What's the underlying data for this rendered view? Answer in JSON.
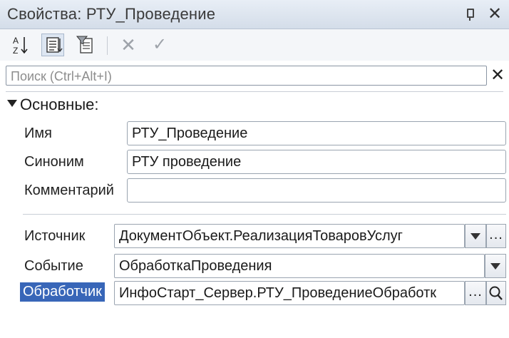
{
  "window": {
    "title": "Свойства: РТУ_Проведение",
    "close_glyph": "✕"
  },
  "toolbar": {
    "sort_label": "A Z",
    "cancel_glyph": "✕",
    "confirm_glyph": "✓"
  },
  "search": {
    "placeholder": "Поиск (Ctrl+Alt+I)",
    "value": "",
    "clear_glyph": "✕"
  },
  "groups": {
    "main": {
      "title": "Основные:"
    }
  },
  "properties": {
    "name": {
      "label": "Имя",
      "value": "РТУ_Проведение"
    },
    "synonym": {
      "label": "Синоним",
      "value": "РТУ проведение"
    },
    "comment": {
      "label": "Комментарий",
      "value": ""
    },
    "source": {
      "label": "Источник",
      "value": "ДокументОбъект.РеализацияТоваровУслуг",
      "select_glyph": "..."
    },
    "event": {
      "label": "Событие",
      "value": "ОбработкаПроведения"
    },
    "handler": {
      "label": "Обработчик",
      "value": "ИнфоСтарт_Сервер.РТУ_ПроведениеОбработк"
    }
  },
  "icons": {
    "window_pin": "pin-icon",
    "window_close": "close-icon",
    "sort": "sort-alphabetical-icon",
    "tree_view": "tree-view-icon",
    "filter": "filter-icon",
    "cancel": "cancel-icon",
    "confirm": "checkmark-icon",
    "dropdown": "chevron-down-icon",
    "search": "magnifier-icon",
    "collapse": "triangle-down-icon"
  },
  "colors": {
    "titlebar": "#d4dde9",
    "selection": "#3866b8",
    "field_border": "#9aa4b0"
  }
}
